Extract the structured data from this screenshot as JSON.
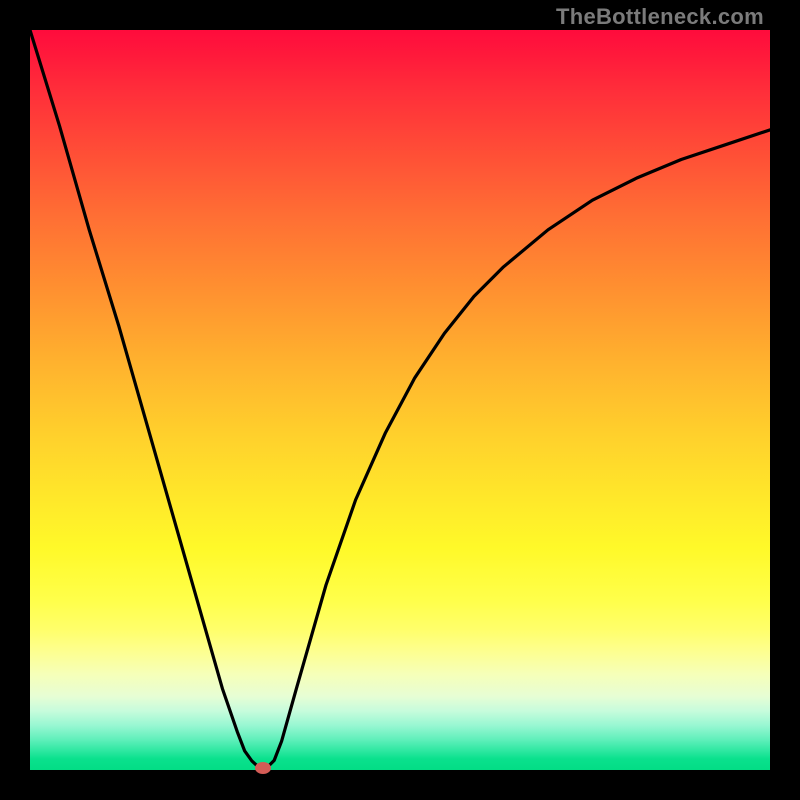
{
  "watermark": "TheBottleneck.com",
  "chart_data": {
    "type": "line",
    "title": "",
    "xlabel": "",
    "ylabel": "",
    "xlim": [
      0,
      100
    ],
    "ylim": [
      0,
      100
    ],
    "series": [
      {
        "name": "curve",
        "x": [
          0,
          4,
          8,
          12,
          16,
          20,
          24,
          26,
          28,
          29,
          30,
          31,
          32,
          33,
          34,
          36,
          38,
          40,
          44,
          48,
          52,
          56,
          60,
          64,
          70,
          76,
          82,
          88,
          94,
          100
        ],
        "y": [
          100,
          87,
          73,
          60,
          46,
          32,
          18,
          11,
          5.2,
          2.6,
          1.2,
          0.3,
          0.3,
          1.3,
          3.9,
          11,
          18,
          25,
          36.5,
          45.5,
          53,
          59,
          64,
          68,
          73,
          77,
          80,
          82.5,
          84.5,
          86.5
        ]
      }
    ],
    "marker": {
      "x": 31.5,
      "y": 0.3
    },
    "background_gradient": {
      "top": "#ff0b3c",
      "mid": "#ffd12c",
      "bottom": "#03dd85"
    }
  }
}
